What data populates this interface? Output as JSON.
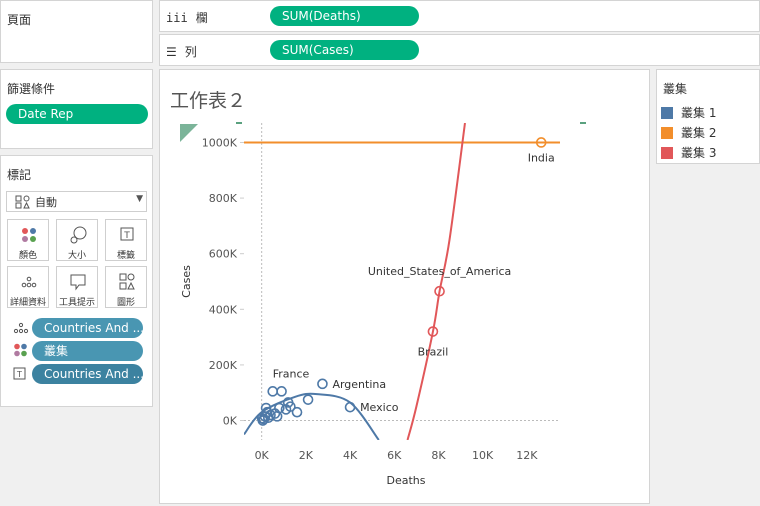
{
  "pages_shelf": {
    "title": "頁面"
  },
  "filters": {
    "title": "篩選條件",
    "pills": [
      "Date Rep"
    ]
  },
  "marks": {
    "title": "標記",
    "mark_type": "自動",
    "buttons": [
      {
        "label": "顏色",
        "icon": "color-icon"
      },
      {
        "label": "大小",
        "icon": "size-icon"
      },
      {
        "label": "標籤",
        "icon": "label-icon"
      },
      {
        "label": "詳細資料",
        "icon": "detail-icon"
      },
      {
        "label": "工具提示",
        "icon": "tooltip-icon"
      },
      {
        "label": "圖形",
        "icon": "shape-icon"
      }
    ],
    "fields": [
      {
        "icon": "detail-icon",
        "label": "Countries And ..."
      },
      {
        "icon": "color-icon",
        "label": "叢集"
      },
      {
        "icon": "label-icon",
        "label": "Countries And ..."
      }
    ]
  },
  "columns_shelf": {
    "label": "欄",
    "icon": "columns-icon",
    "pill": "SUM(Deaths)"
  },
  "rows_shelf": {
    "label": "列",
    "icon": "rows-icon",
    "pill": "SUM(Cases)"
  },
  "sheet": {
    "title": "工作表２"
  },
  "legend": {
    "title": "叢集",
    "items": [
      {
        "label": "叢集 1",
        "color": "#4e79a7"
      },
      {
        "label": "叢集 2",
        "color": "#f28e2b"
      },
      {
        "label": "叢集 3",
        "color": "#e15759"
      }
    ]
  },
  "chart_data": {
    "type": "scatter",
    "xlabel": "Deaths",
    "ylabel": "Cases",
    "x_ticks": [
      "0K",
      "2K",
      "4K",
      "6K",
      "8K",
      "10K",
      "12K"
    ],
    "y_ticks": [
      "0K",
      "200K",
      "400K",
      "600K",
      "800K",
      "1000K"
    ],
    "xlim": [
      -800,
      13500
    ],
    "ylim": [
      -70000,
      1070000
    ],
    "series": [
      {
        "name": "叢集 1",
        "color": "#4e79a7",
        "points": [
          {
            "x": 2750,
            "y": 132000,
            "label": "Argentina"
          },
          {
            "x": 4000,
            "y": 48000,
            "label": "Mexico"
          },
          {
            "x": 500,
            "y": 105000,
            "label": "France"
          },
          {
            "x": 900,
            "y": 105000
          },
          {
            "x": 2100,
            "y": 75000
          },
          {
            "x": 1200,
            "y": 65000
          },
          {
            "x": 1600,
            "y": 30000
          },
          {
            "x": 1100,
            "y": 40000
          },
          {
            "x": 800,
            "y": 45000
          },
          {
            "x": 200,
            "y": 45000
          },
          {
            "x": 600,
            "y": 25000
          },
          {
            "x": 400,
            "y": 20000
          },
          {
            "x": 150,
            "y": 15000
          },
          {
            "x": 300,
            "y": 10000
          },
          {
            "x": 100,
            "y": 5000
          },
          {
            "x": 50,
            "y": 0
          },
          {
            "x": 20,
            "y": 8000
          },
          {
            "x": 700,
            "y": 15000
          },
          {
            "x": 250,
            "y": 30000
          },
          {
            "x": 1300,
            "y": 50000
          }
        ]
      },
      {
        "name": "叢集 2",
        "color": "#f28e2b",
        "points": [
          {
            "x": 12650,
            "y": 1000000,
            "label": "India"
          }
        ]
      },
      {
        "name": "叢集 3",
        "color": "#e15759",
        "points": [
          {
            "x": 8050,
            "y": 465000,
            "label": "United_States_of_America"
          },
          {
            "x": 7750,
            "y": 320000,
            "label": "Brazil"
          }
        ]
      }
    ],
    "trend_lines": [
      {
        "series": "叢集 1",
        "points": [
          [
            -800,
            -50000
          ],
          [
            0,
            30000
          ],
          [
            1500,
            85000
          ],
          [
            2500,
            95000
          ],
          [
            4000,
            65000
          ],
          [
            5300,
            -70000
          ]
        ]
      },
      {
        "series": "叢集 2",
        "points": [
          [
            -800,
            1000000
          ],
          [
            13500,
            1000000
          ]
        ]
      },
      {
        "series": "叢集 3",
        "points": [
          [
            6600,
            -70000
          ],
          [
            7000,
            50000
          ],
          [
            7750,
            320000
          ],
          [
            8050,
            465000
          ],
          [
            8500,
            650000
          ],
          [
            9200,
            1070000
          ]
        ]
      }
    ]
  }
}
